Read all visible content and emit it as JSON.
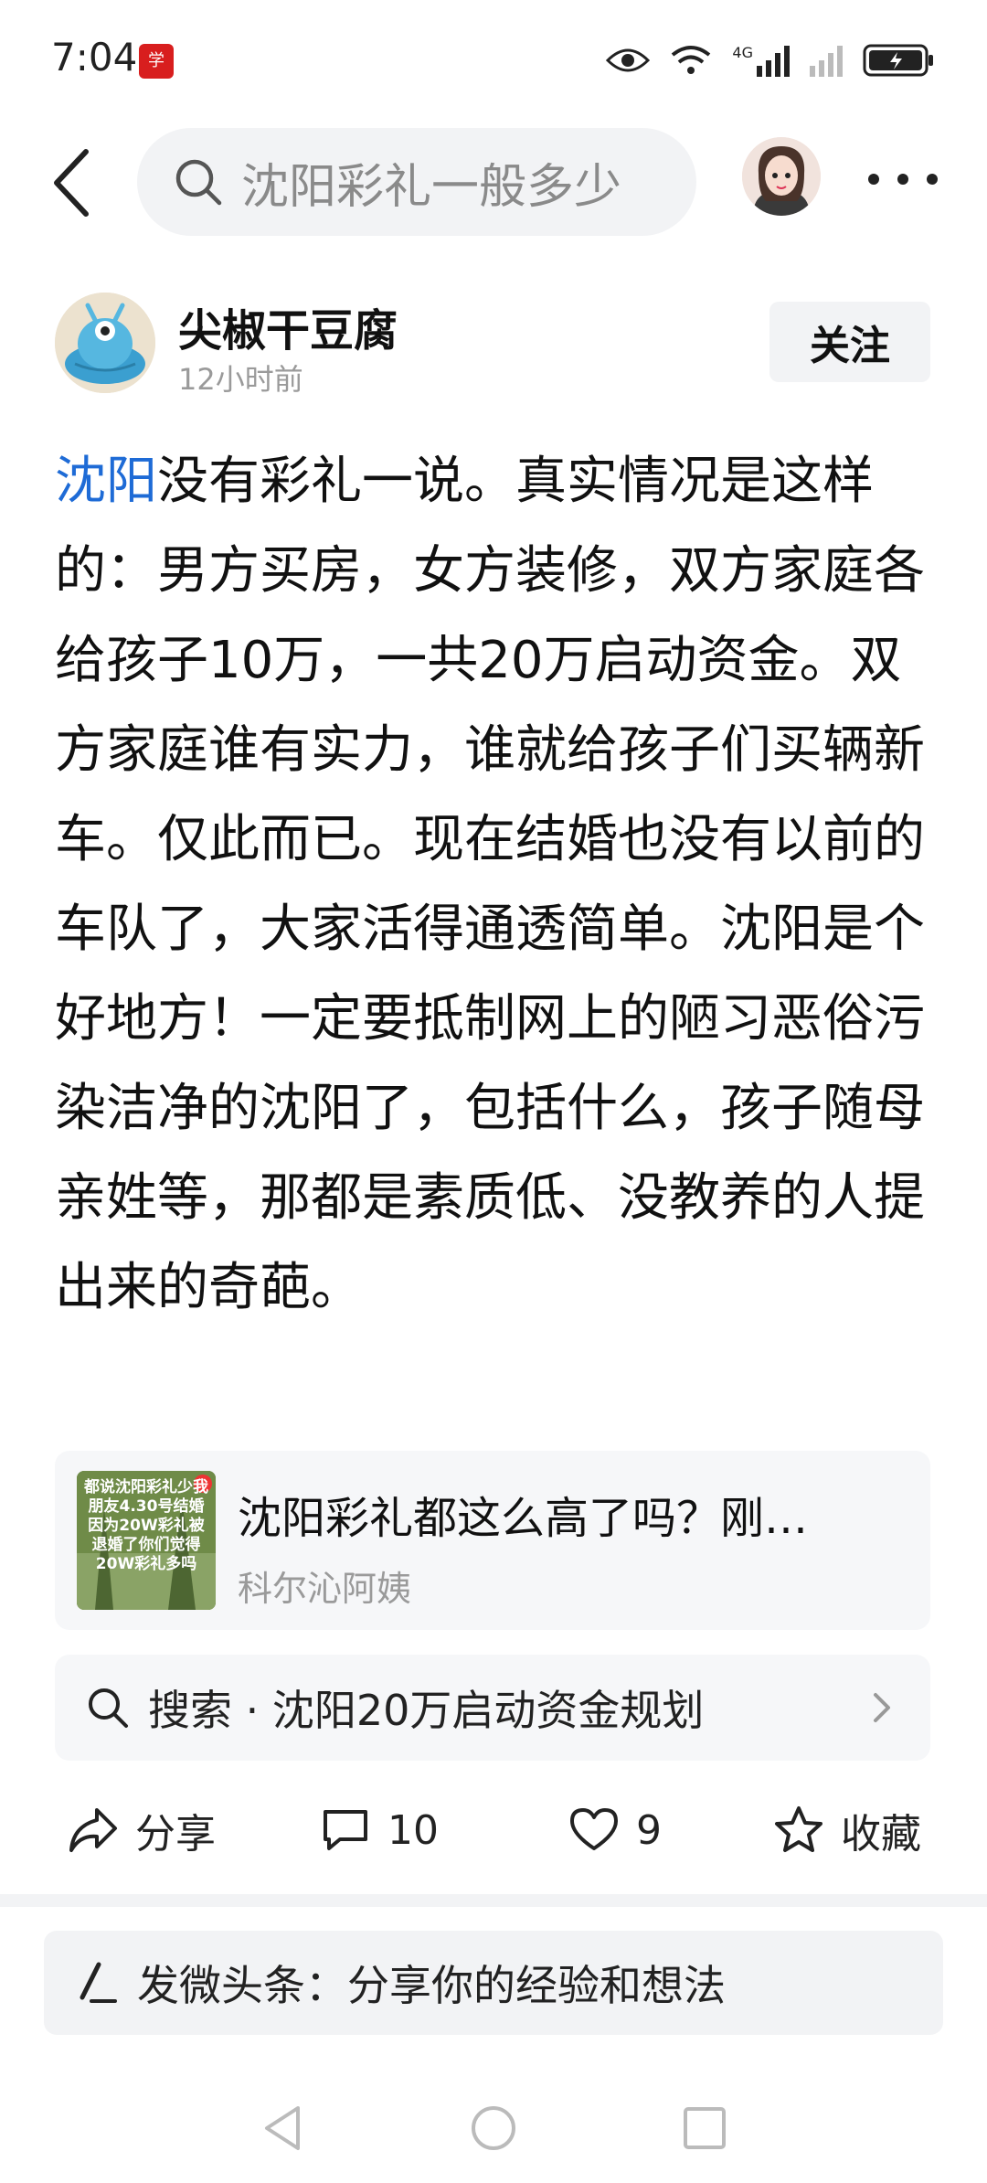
{
  "status_bar": {
    "time": "7:04",
    "app_badge": "学",
    "network": "4G"
  },
  "top_bar": {
    "search_text": "沈阳彩礼一般多少",
    "icons": [
      "back-arrow-icon",
      "search-icon",
      "avatar",
      "more-icon"
    ]
  },
  "post": {
    "author_name": "尖椒干豆腐",
    "time": "12小时前",
    "follow_label": "关注",
    "body_link": "沈阳",
    "body_text": "没有彩礼一说。真实情况是这样的：男方买房，女方装修，双方家庭各给孩子10万，一共20万启动资金。双方家庭谁有实力，谁就给孩子们买辆新车。仅此而已。现在结婚也没有以前的车队了，大家活得通透简单。沈阳是个好地方！一定要抵制网上的陋习恶俗污染洁净的沈阳了，包括什么，孩子随母亲姓等，那都是素质低、没教养的人提出来的奇葩。"
  },
  "related": {
    "title": "沈阳彩礼都这么高了吗？刚…",
    "source": "科尔沁阿姨",
    "thumb_text": "都说沈阳彩礼少我朋友4.30号结婚因为20W彩礼被退婚了你们觉得20W彩礼多吗"
  },
  "suggestion": {
    "text": "搜索 · 沈阳20万启动资金规划"
  },
  "actions": {
    "share_label": "分享",
    "comment_count": "10",
    "like_count": "9",
    "favorite_label": "收藏"
  },
  "compose": {
    "placeholder": "发微头条：分享你的经验和想法"
  },
  "colors": {
    "link": "#1e6bd6",
    "background": "#ffffff",
    "card": "#f6f7f9"
  }
}
